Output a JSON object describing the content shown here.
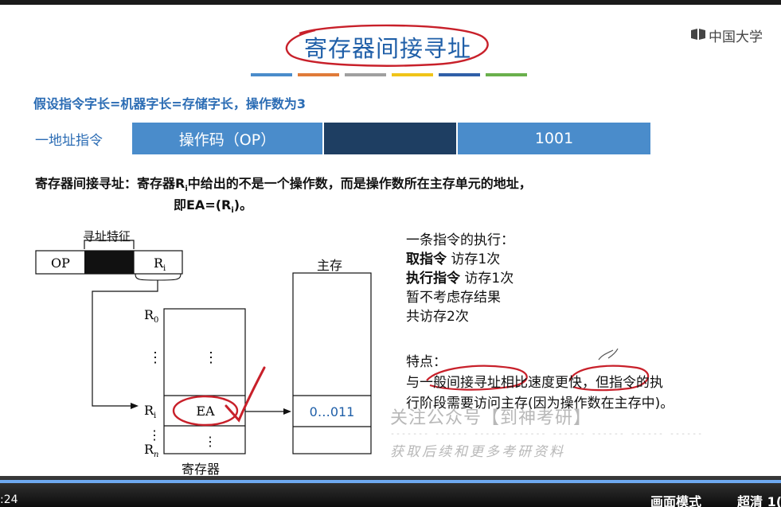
{
  "slide": {
    "title": "寄存器间接寻址",
    "brand": "中国大学",
    "stripe_colors": [
      "#4a8ccb",
      "#e07b39",
      "#a0a0a0",
      "#f0c419",
      "#2f5fa8",
      "#6ab04c"
    ],
    "assumption": "假设指令字长=机器字长=存储字长，操作数为3",
    "instruction": {
      "label": "一地址指令",
      "opcode": "操作码（OP）",
      "address": "1001"
    },
    "definition": {
      "line1_prefix": "寄存器间接寻址：寄存器R",
      "line1_sub": "i",
      "line1_suffix": "中给出的不是一个操作数，而是操作数所在主存单元的地址，",
      "line2_prefix": "即EA=(R",
      "line2_sub": "i",
      "line2_suffix": ")。"
    },
    "diagram": {
      "addressing_feature_label": "寻址特征",
      "op_label": "OP",
      "ri_field": "R",
      "ri_sub": "i",
      "r0": "R",
      "r0_sub": "0",
      "ri_row": "R",
      "ri_row_sub": "i",
      "rn": "R",
      "rn_sub": "n",
      "vdots": "⋮",
      "ea": "EA",
      "memory_label": "主存",
      "memory_value": "0…011",
      "register_label": "寄存器"
    },
    "notes": {
      "heading": "一条指令的执行：",
      "fetch_bold": "取指令",
      "fetch_rest": " 访存1次",
      "exec_bold": "执行指令",
      "exec_rest": " 访存1次",
      "no_store": "暂不考虑存结果",
      "total": "共访存2次"
    },
    "features": {
      "heading": "特点：",
      "line1": "与一般间接寻址相比速度更快，但指令的执",
      "line2": "行阶段需要访问主存(因为操作数在主存中)。"
    },
    "watermark": {
      "line1": "关注公众号【到神考研】",
      "line2": "获取后续和更多考研资料"
    }
  },
  "player": {
    "time": ":24",
    "mode_button": "画面模式",
    "quality_button": "超清 1("
  }
}
